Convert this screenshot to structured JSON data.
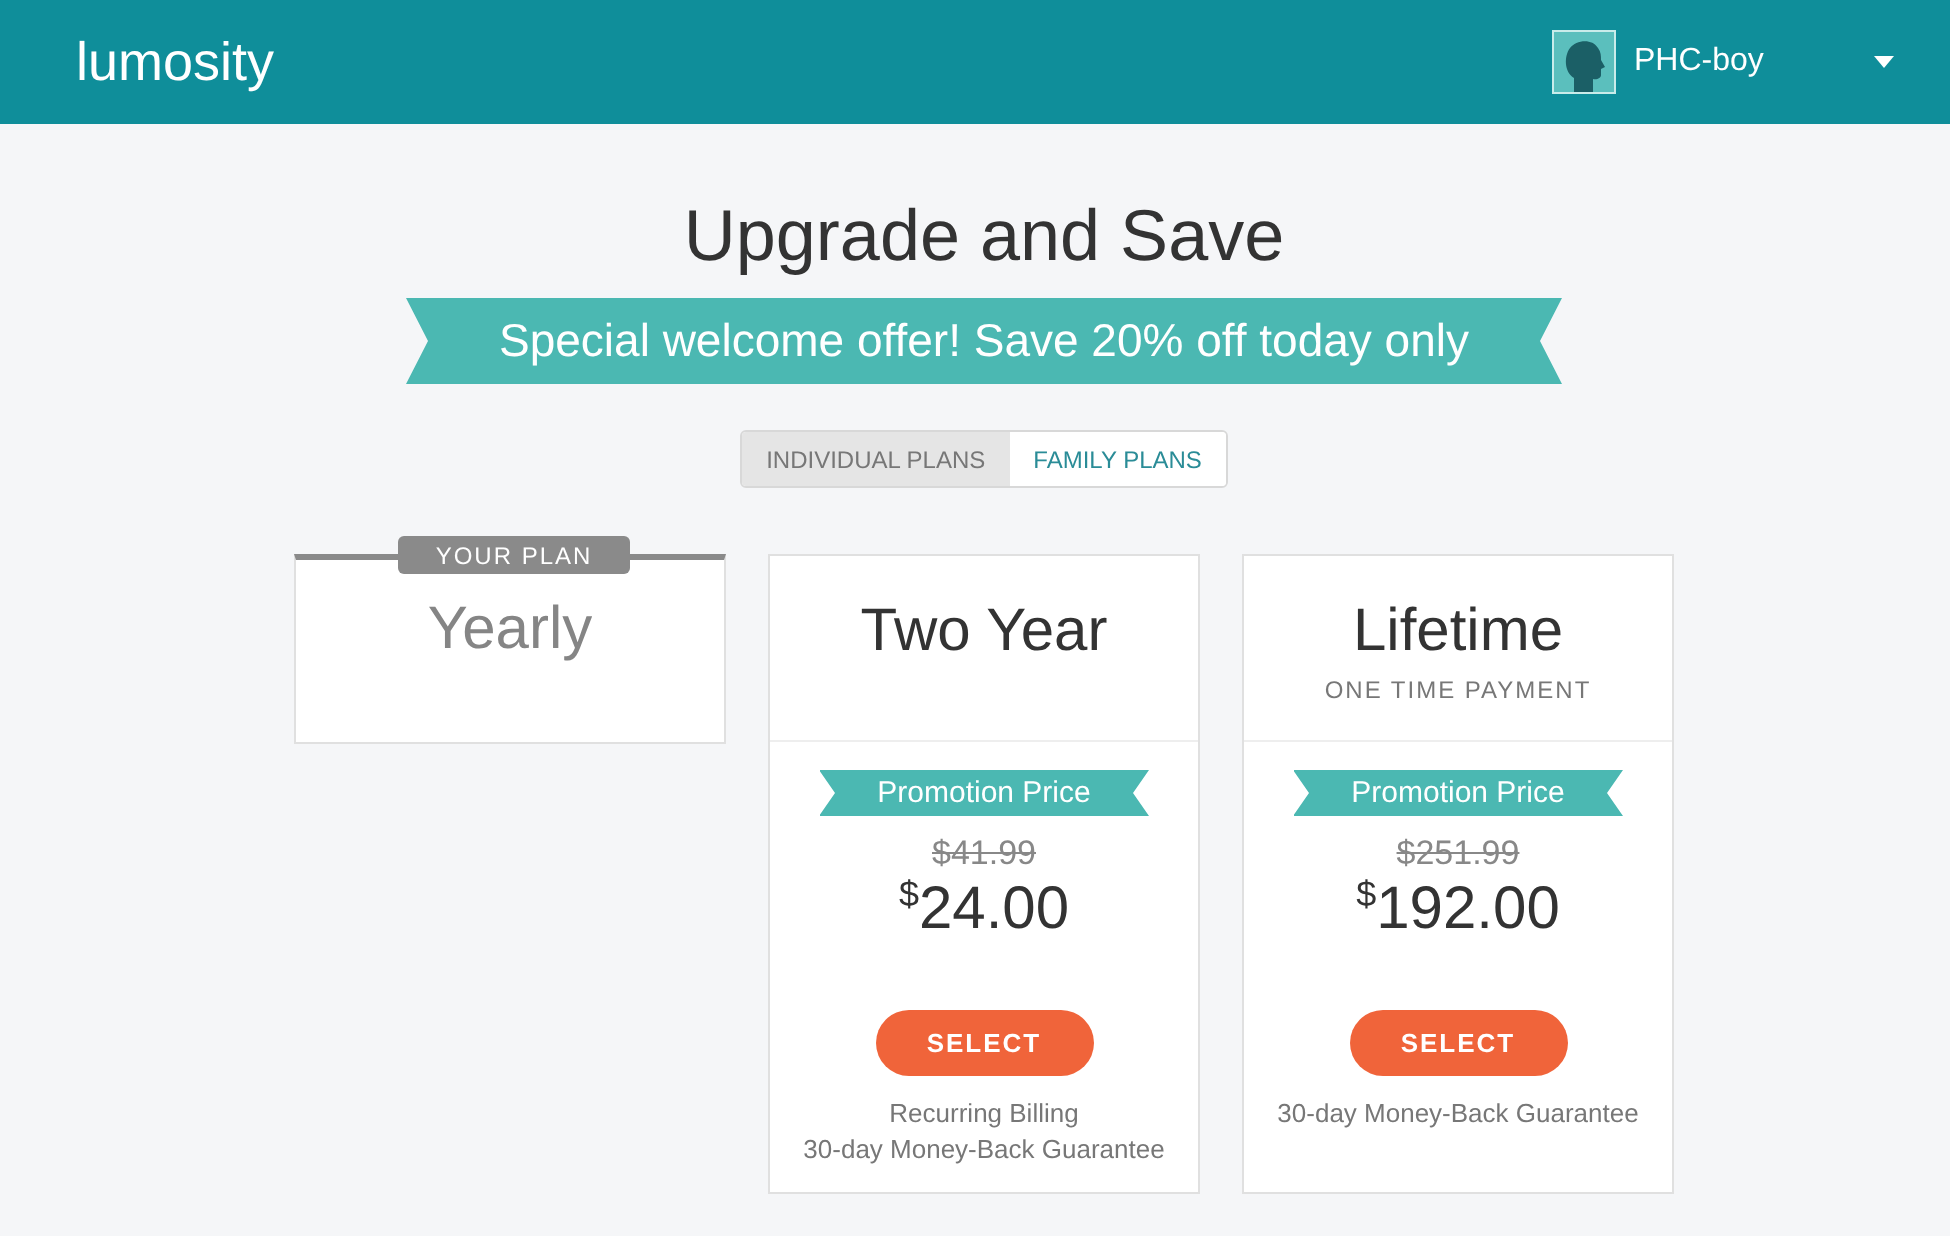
{
  "header": {
    "logo": "lumosity",
    "user": {
      "name": "PHC-boy"
    }
  },
  "title": "Upgrade and Save",
  "banner": "Special welcome offer! Save 20% off today only",
  "plan_tabs": [
    {
      "label": "INDIVIDUAL PLANS",
      "selected": true
    },
    {
      "label": "FAMILY PLANS",
      "selected": false
    }
  ],
  "plans": [
    {
      "kind": "current",
      "badge": "YOUR PLAN",
      "name": "Yearly"
    },
    {
      "kind": "offer",
      "name": "Two Year",
      "promotion": "Promotion Price",
      "old_price": "$41.99",
      "currency": "$",
      "price": "24.00",
      "button": "SELECT",
      "notes": [
        "Recurring Billing",
        "30-day Money-Back Guarantee"
      ]
    },
    {
      "kind": "offer",
      "name": "Lifetime",
      "subtitle": "ONE TIME PAYMENT",
      "promotion": "Promotion Price",
      "old_price": "$251.99",
      "currency": "$",
      "price": "192.00",
      "button": "SELECT",
      "notes": [
        "30-day Money-Back Guarantee"
      ]
    }
  ]
}
